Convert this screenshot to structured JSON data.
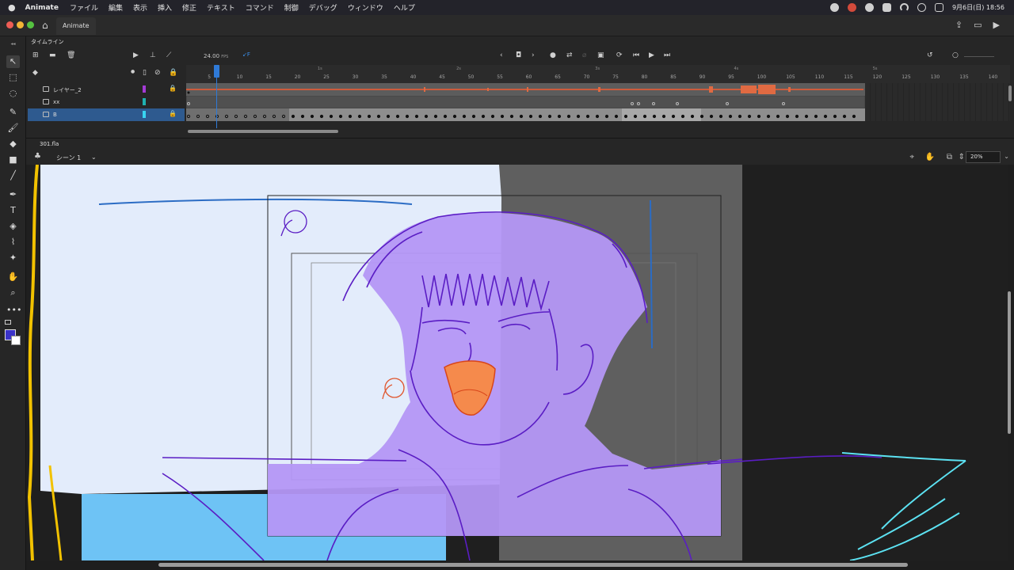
{
  "menubar": {
    "app_name": "Animate",
    "items": [
      "ファイル",
      "編集",
      "表示",
      "挿入",
      "修正",
      "テキスト",
      "コマンド",
      "制御",
      "デバッグ",
      "ウィンドウ",
      "ヘルプ"
    ],
    "clock": "9月6日(日)  18:56"
  },
  "window": {
    "tab_label": "Animate"
  },
  "timeline": {
    "title": "タイムライン",
    "fps_value": "24.00",
    "fps_unit": "FPS",
    "frame_suffix": "F",
    "ruler_numbers": [
      "5",
      "10",
      "15",
      "20",
      "25",
      "30",
      "35",
      "40",
      "45",
      "50",
      "55",
      "60",
      "65",
      "70",
      "75",
      "80",
      "85",
      "90",
      "95",
      "100",
      "105",
      "110",
      "115",
      "120",
      "125",
      "130",
      "135",
      "140"
    ],
    "ruler_seconds": [
      "1s",
      "2s",
      "3s",
      "4s",
      "5s"
    ],
    "current_frame": 5,
    "layers": [
      {
        "name": "レイヤー_2",
        "color": "#a43bd6",
        "locked": true
      },
      {
        "name": "xx",
        "color": "#1fb1b1",
        "locked": false
      },
      {
        "name": "B",
        "color": "#39d4f0",
        "locked": true
      }
    ]
  },
  "stage_header": {
    "file_tab": "301.fla",
    "scene_label": "シーン 1",
    "zoom": "20%"
  },
  "colors": {
    "accent": "#2f7ad7",
    "stroke_fill": "#3a32c8"
  }
}
